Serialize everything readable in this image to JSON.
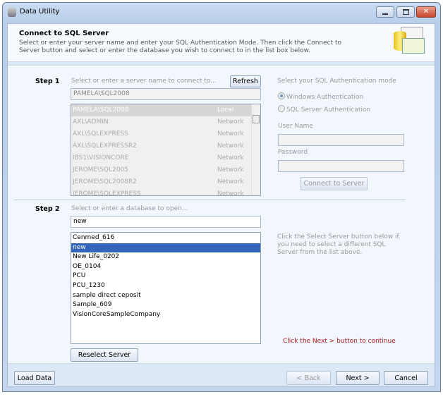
{
  "window": {
    "title": "Data Utility",
    "icon": "database-icon"
  },
  "header": {
    "title": "Connect to SQL Server",
    "description": "Select or enter your server name and enter your SQL Authentication Mode.  Then click the Connect to Server button and select or enter the database you wish to connect to in the list box below."
  },
  "step1": {
    "label": "Step 1",
    "hint": "Select or enter a server name to connect to...",
    "refresh": "Refresh",
    "server_value": "PAMELA\\SQL2008",
    "servers": [
      {
        "name": "PAMELA\\SQL2008",
        "type": "Local"
      },
      {
        "name": "AXL\\ADMIN",
        "type": "Network"
      },
      {
        "name": "AXL\\SQLEXPRESS",
        "type": "Network"
      },
      {
        "name": "AXL\\SQLEXPRESSR2",
        "type": "Network"
      },
      {
        "name": "IBS1\\VISIONCORE",
        "type": "Network"
      },
      {
        "name": "JEROME\\SQL2005",
        "type": "Network"
      },
      {
        "name": "JEROME\\SQL2008R2",
        "type": "Network"
      },
      {
        "name": "JEROME\\SQLEXPRESS",
        "type": "Network"
      }
    ]
  },
  "auth": {
    "title": "Select your SQL Authentication mode",
    "windows": "Windows Authentication",
    "sql": "SQL Server Authentication",
    "selected": "windows",
    "user_label": "User Name",
    "user_value": "",
    "password_label": "Password",
    "password_value": "",
    "connect": "Connect to Server"
  },
  "step2": {
    "label": "Step 2",
    "hint": "Select or enter a database to open...",
    "db_value": "new",
    "databases": [
      "Cenmed_616",
      "new",
      "New Life_0202",
      "OE_0104",
      "PCU",
      "PCU_1230",
      "sample direct ceposit",
      "Sample_609",
      "VisionCoreSampleCompany"
    ],
    "selected_index": 1,
    "info": "Click the Select Server button below if you need to select a different SQL Server from the list above.",
    "reselect": "Reselect Server",
    "continue_msg": "Click the Next > button to continue",
    "continue_color": "#b01818"
  },
  "footer": {
    "load": "Load Data",
    "back": "< Back",
    "next": "Next >",
    "cancel": "Cancel"
  }
}
